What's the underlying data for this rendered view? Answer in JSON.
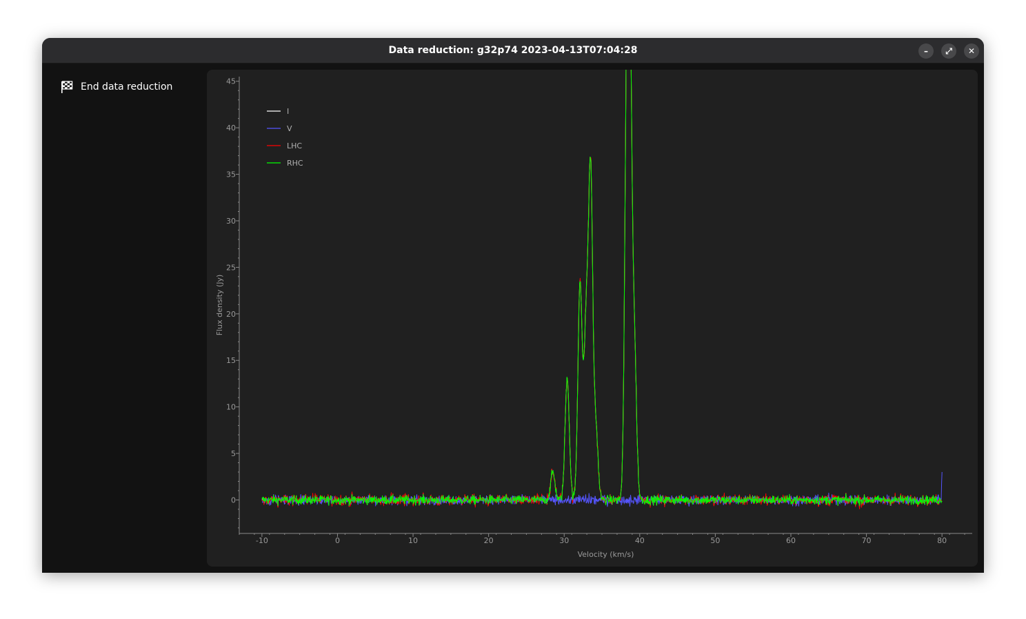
{
  "window": {
    "title": "Data reduction: g32p74 2023-04-13T07:04:28",
    "controls": {
      "minimize": "–",
      "maximize": "⤢",
      "close": "✕"
    }
  },
  "sidebar": {
    "items": [
      {
        "label": "End data reduction",
        "icon": "checkered-flag-icon"
      }
    ]
  },
  "chart_data": {
    "type": "line",
    "xlabel": "Velocity (km/s)",
    "ylabel": "Flux density (Jy)",
    "xlim": [
      -13,
      84
    ],
    "ylim": [
      -3.6,
      45.5
    ],
    "x_ticks": [
      -10,
      0,
      10,
      20,
      30,
      40,
      50,
      60,
      70,
      80
    ],
    "y_ticks": [
      0,
      5,
      10,
      15,
      20,
      25,
      30,
      35,
      40,
      45
    ],
    "x_range": [
      -10,
      80
    ],
    "legend_position": "top-left",
    "grid": false,
    "series": [
      {
        "name": "I",
        "color": "#ffffff"
      },
      {
        "name": "V",
        "color": "#5555ff"
      },
      {
        "name": "LHC",
        "color": "#ff0000"
      },
      {
        "name": "RHC",
        "color": "#00ff00"
      }
    ],
    "features": {
      "peaks_rhc_lhc": [
        {
          "x": 28.5,
          "y": 3.0
        },
        {
          "x": 30.4,
          "y": 13.2
        },
        {
          "x": 32.1,
          "y": 23.5
        },
        {
          "x": 32.9,
          "y": 18.0
        },
        {
          "x": 33.5,
          "y": 34.8
        },
        {
          "x": 34.2,
          "y": 7.5
        },
        {
          "x": 38.3,
          "y": 41.8
        },
        {
          "x": 38.7,
          "y": 43.3
        },
        {
          "x": 39.3,
          "y": 15.5
        }
      ],
      "v_edge_spike": {
        "x": 80,
        "y": 3.0
      },
      "noise_rms": 0.35
    }
  }
}
